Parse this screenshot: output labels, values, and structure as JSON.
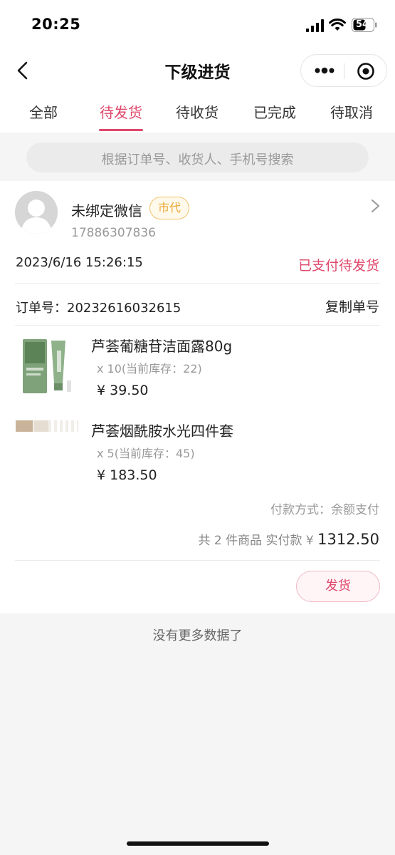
{
  "status_bar": {
    "time": "20:25",
    "battery": "54"
  },
  "nav": {
    "title": "下级进货"
  },
  "tabs": [
    {
      "label": "全部"
    },
    {
      "label": "待发货"
    },
    {
      "label": "待收货"
    },
    {
      "label": "已完成"
    },
    {
      "label": "待取消"
    }
  ],
  "active_tab": "待发货",
  "search": {
    "placeholder": "根据订单号、收货人、手机号搜索"
  },
  "order": {
    "user": {
      "name": "未绑定微信",
      "badge": "市代",
      "phone": "17886307836"
    },
    "datetime": "2023/6/16 15:26:15",
    "status": "已支付待发货",
    "order_no_label": "订单号：",
    "order_no": "20232616032615",
    "copy_label": "复制单号",
    "products": [
      {
        "name": "芦荟葡糖苷洁面露80g",
        "qty": "x 10(当前库存：22)",
        "price": "¥ 39.50"
      },
      {
        "name": "芦荟烟酰胺水光四件套",
        "qty": "x 5(当前库存：45)",
        "price": "¥ 183.50"
      }
    ],
    "payment": "付款方式：余额支付",
    "summary": "共 2 件商品 实付款 ¥",
    "total": "1312.50",
    "ship_label": "发货"
  },
  "footer": {
    "no_more": "没有更多数据了"
  },
  "colors": {
    "accent": "#e0476b",
    "badge": "#e9a732",
    "background": "#f5f5f5"
  },
  "icons": [
    "back-icon",
    "more-dots-icon",
    "target-icon",
    "chevron-right-icon",
    "signal-icon",
    "wifi-icon",
    "battery-icon"
  ]
}
